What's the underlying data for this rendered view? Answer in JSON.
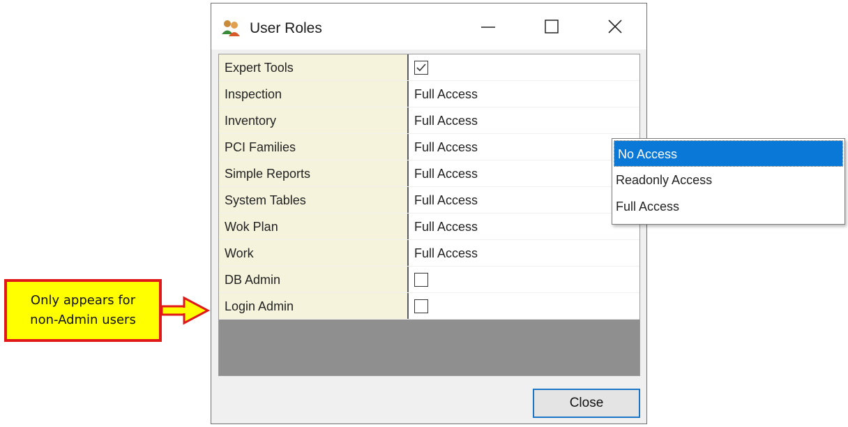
{
  "window": {
    "title": "User Roles",
    "app_icon": "users-icon",
    "controls": [
      "minimize-icon",
      "maximize-icon",
      "close-icon"
    ]
  },
  "grid": {
    "rows": [
      {
        "name": "Expert Tools",
        "type": "checkbox",
        "checked": true
      },
      {
        "name": "Inspection",
        "type": "text",
        "value": "Full Access"
      },
      {
        "name": "Inventory",
        "type": "text",
        "value": "Full Access"
      },
      {
        "name": "PCI Families",
        "type": "text",
        "value": "Full Access"
      },
      {
        "name": "Simple Reports",
        "type": "text",
        "value": "Full Access"
      },
      {
        "name": "System Tables",
        "type": "text",
        "value": "Full Access"
      },
      {
        "name": "Wok Plan",
        "type": "text",
        "value": "Full Access"
      },
      {
        "name": "Work",
        "type": "text",
        "value": "Full Access"
      },
      {
        "name": "DB Admin",
        "type": "checkbox",
        "checked": false
      },
      {
        "name": "Login Admin",
        "type": "checkbox",
        "checked": false
      }
    ]
  },
  "close_button": {
    "label": "Close"
  },
  "dropdown": {
    "options": [
      "No Access",
      "Readonly Access",
      "Full Access"
    ],
    "selected": "No Access"
  },
  "annotation": {
    "line1": "Only appears for",
    "line2": "non-Admin users"
  },
  "colors": {
    "name_column_bg": "#f5f3dc",
    "selection": "#0a78d7",
    "callout_fill": "#ffff00",
    "callout_border": "#e01818",
    "focus_border": "#1c76c8"
  }
}
